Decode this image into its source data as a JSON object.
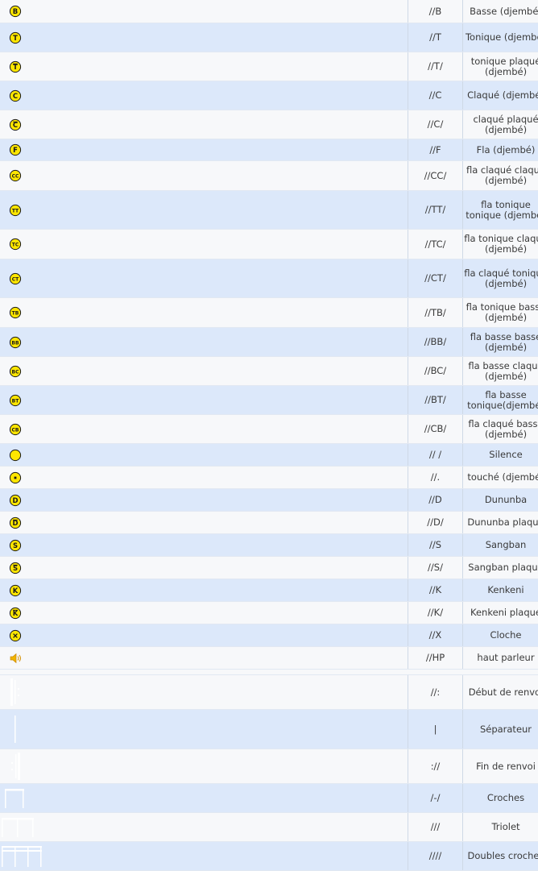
{
  "rows": [
    {
      "symbol": "B",
      "code": "//B",
      "name": "Basse (djembé)",
      "h": 28
    },
    {
      "symbol": "T",
      "code": "//T",
      "name": "Tonique (djembé)",
      "h": 35
    },
    {
      "symbol": "T-plaque",
      "code": "//T/",
      "name": "tonique plaqué (djembé)",
      "h": 35
    },
    {
      "symbol": "C",
      "code": "//C",
      "name": "Claqué (djembé)",
      "h": 35
    },
    {
      "symbol": "C-plaque",
      "code": "//C/",
      "name": "claqué plaqué (djembé)",
      "h": 35
    },
    {
      "symbol": "F",
      "code": "//F",
      "name": "Fla (djembé)",
      "h": 26
    },
    {
      "symbol": "CC",
      "code": "//CC/",
      "name": "fla claqué claqué (djembé)",
      "h": 36
    },
    {
      "symbol": "TT",
      "code": "//TT/",
      "name": "fla tonique tonique (djembé)",
      "h": 47
    },
    {
      "symbol": "TC",
      "code": "//TC/",
      "name": "fla tonique claque (djembé)",
      "h": 36
    },
    {
      "symbol": "CT",
      "code": "//CT/",
      "name": "fla claqué tonique (djembé)",
      "h": 47
    },
    {
      "symbol": "TB",
      "code": "//TB/",
      "name": "fla tonique basse (djembé)",
      "h": 36
    },
    {
      "symbol": "BB",
      "code": "//BB/",
      "name": "fla basse basse (djembé)",
      "h": 35
    },
    {
      "symbol": "BC",
      "code": "//BC/",
      "name": "fla basse claqué (djembé)",
      "h": 35
    },
    {
      "symbol": "BT",
      "code": "//BT/",
      "name": "fla basse tonique(djembé)",
      "h": 35
    },
    {
      "symbol": "CB",
      "code": "//CB/",
      "name": "fla claqué basse (djembé)",
      "h": 35
    },
    {
      "symbol": "silence",
      "code": "// /",
      "name": "Silence",
      "h": 27
    },
    {
      "symbol": "touche",
      "code": "//.",
      "name": "touché (djembé)",
      "h": 27
    },
    {
      "symbol": "D",
      "code": "//D",
      "name": "Dununba",
      "h": 27
    },
    {
      "symbol": "D-plaque",
      "code": "//D/",
      "name": "Dununba plaqué",
      "h": 27
    },
    {
      "symbol": "S",
      "code": "//S",
      "name": "Sangban",
      "h": 27
    },
    {
      "symbol": "S-plaque",
      "code": "//S/",
      "name": "Sangban plaqué",
      "h": 27
    },
    {
      "symbol": "K",
      "code": "//K",
      "name": "Kenkeni",
      "h": 27
    },
    {
      "symbol": "K-plaque",
      "code": "//K/",
      "name": "Kenkeni plaqué",
      "h": 27
    },
    {
      "symbol": "X",
      "code": "//X",
      "name": "Cloche",
      "h": 27
    },
    {
      "symbol": "speaker",
      "code": "//HP",
      "name": "haut parleur",
      "h": 27
    },
    {
      "symbol": "spacer",
      "code": "",
      "name": "",
      "h": 6
    },
    {
      "symbol": "debut-renvoi",
      "code": "//:",
      "name": "Début de renvoi",
      "h": 42
    },
    {
      "symbol": "separateur",
      "code": "|",
      "name": "Séparateur",
      "h": 48
    },
    {
      "symbol": "fin-renvoi",
      "code": "://",
      "name": "Fin de renvoi",
      "h": 42
    },
    {
      "symbol": "croches",
      "code": "/-/",
      "name": "Croches",
      "h": 35
    },
    {
      "symbol": "triolet",
      "code": "///",
      "name": "Triolet",
      "h": 35
    },
    {
      "symbol": "doubles-croches",
      "code": "////",
      "name": "Doubles croches",
      "h": 35
    }
  ],
  "colors": {
    "row_odd": "#f7f8fa",
    "row_even": "#dce8fa",
    "icon_fill": "#ffe600",
    "icon_stroke": "#1a1a1a",
    "bar_white": "#ffffff"
  }
}
